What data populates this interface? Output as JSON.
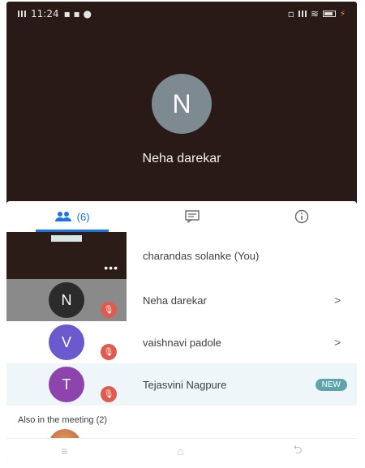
{
  "status_bar": {
    "time": "11:24"
  },
  "stage": {
    "avatar_letter": "N",
    "name": "Neha darekar"
  },
  "tabs": [
    {
      "label": "(6)",
      "icon": "people-icon"
    },
    {
      "icon": "chat-icon"
    },
    {
      "icon": "info-icon"
    }
  ],
  "participants": [
    {
      "name": "charandas solanke (You)"
    },
    {
      "name": "Neha darekar",
      "letter": "N",
      "color": "#2b2b2b"
    },
    {
      "name": "vaishnavi padole",
      "letter": "V",
      "color": "#6a5acd"
    },
    {
      "name": "Tejasvini Nagpure",
      "letter": "T",
      "color": "#8e44ad",
      "badge": "NEW"
    }
  ],
  "also_section": {
    "title": "Also in the meeting (2)"
  },
  "colors": {
    "accent": "#1a73e8",
    "mute": "#e05b4f",
    "badge": "#5fa4a8"
  }
}
